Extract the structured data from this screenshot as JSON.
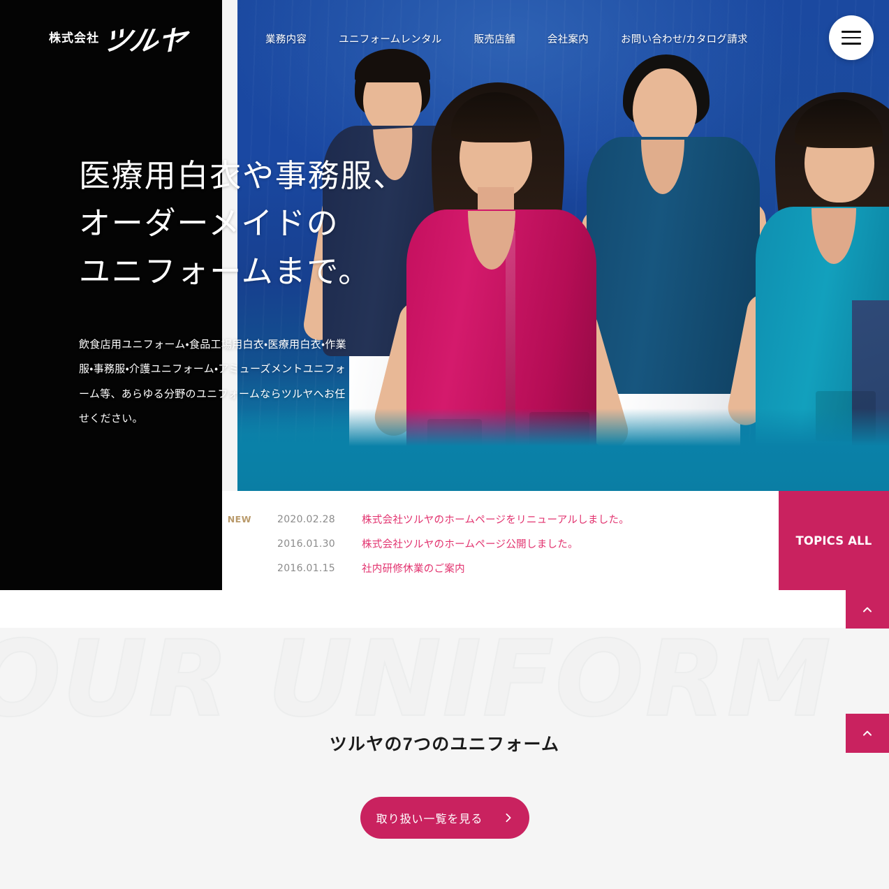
{
  "header": {
    "logo_prefix": "株式会社",
    "logo_name": "ツルヤ",
    "nav": [
      {
        "label": "業務内容"
      },
      {
        "label": "ユニフォームレンタル"
      },
      {
        "label": "販売店舗"
      },
      {
        "label": "会社案内"
      },
      {
        "label": "お問い合わせ/カタログ請求"
      }
    ],
    "menu_button_label": "menu"
  },
  "hero": {
    "heading_lines": [
      "医療用白衣や事務服、",
      "オーダーメイドの",
      "ユニフォームまで。"
    ],
    "lead": "飲食店用ユニフォーム・食品工場用白衣・医療用白衣・作業服・事務服・介護ユニフォーム・アミューズメントユニフォーム等、あらゆる分野のユニフォームならツルヤへお任せください。"
  },
  "topics": {
    "items": [
      {
        "badge": "NEW",
        "date": "2020.02.28",
        "title": "株式会社ツルヤのホームページをリニューアルしました。"
      },
      {
        "badge": "",
        "date": "2016.01.30",
        "title": "株式会社ツルヤのホームページ公開しました。"
      },
      {
        "badge": "",
        "date": "2016.01.15",
        "title": "社内研修休業のご案内"
      }
    ],
    "all_label": "TOPICS ALL"
  },
  "carousel": {
    "slides": [
      "1",
      "2",
      "3",
      "4"
    ],
    "active_index": 0
  },
  "uniform": {
    "background_word": "OUR UNIFORM",
    "section_title": "ツルヤの7つのユニフォーム",
    "cta_label": "取り扱い一覧を見る"
  },
  "colors": {
    "accent_crimson": "#c9225f",
    "topic_link": "#e2336f",
    "new_badge": "#b99a6b",
    "hero_blue": "#1b49a0",
    "hero_teal": "#0a81a8",
    "page_bg": "#f5f5f5",
    "black_panel": "#040404"
  }
}
